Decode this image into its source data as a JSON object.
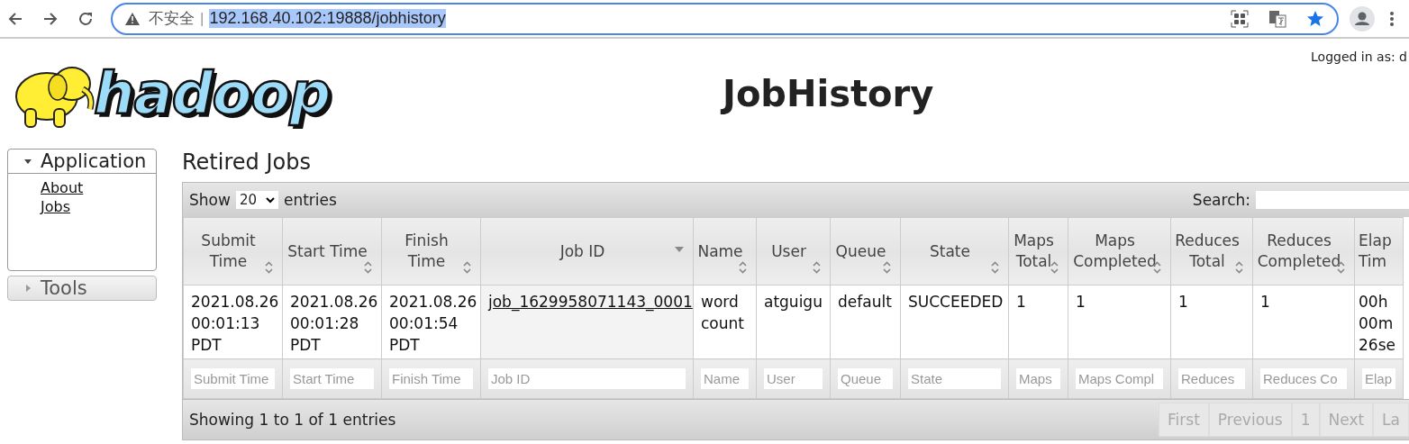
{
  "browser": {
    "security_label": "不安全",
    "separator": "|",
    "url": "192.168.40.102:19888/jobhistory"
  },
  "header": {
    "logo_text": "hadoop",
    "title": "JobHistory",
    "login": "Logged in as: d"
  },
  "sidebar": [
    {
      "label": "Application",
      "expanded": true,
      "items": [
        "About",
        "Jobs"
      ]
    },
    {
      "label": "Tools",
      "expanded": false
    }
  ],
  "main": {
    "heading": "Retired Jobs",
    "show_label": "Show",
    "page_size": "20",
    "entries_label": "entries",
    "search_label": "Search:",
    "columns": [
      {
        "label": "Submit Time",
        "sorted": false
      },
      {
        "label": "Start Time",
        "sorted": false
      },
      {
        "label": "Finish Time",
        "sorted": false
      },
      {
        "label": "Job ID",
        "sorted": true
      },
      {
        "label": "Name",
        "sorted": false
      },
      {
        "label": "User",
        "sorted": false
      },
      {
        "label": "Queue",
        "sorted": false
      },
      {
        "label": "State",
        "sorted": false
      },
      {
        "label": "Maps Total",
        "sorted": false
      },
      {
        "label": "Maps Completed",
        "sorted": false
      },
      {
        "label": "Reduces Total",
        "sorted": false
      },
      {
        "label": "Reduces Completed",
        "sorted": false
      },
      {
        "label": "Elap Tim"
      }
    ],
    "rows": [
      {
        "cells": [
          "2021.08.26 00:01:13 PDT",
          "2021.08.26 00:01:28 PDT",
          "2021.08.26 00:01:54 PDT",
          "job_1629958071143_0001",
          "word count",
          "atguigu",
          "default",
          "SUCCEEDED",
          "1",
          "1",
          "1",
          "1",
          "00h 00m 26se"
        ]
      }
    ],
    "filters": [
      {
        "placeholder": "Submit Time"
      },
      {
        "placeholder": "Start Time"
      },
      {
        "placeholder": "Finish Time"
      },
      {
        "placeholder": "Job ID"
      },
      {
        "placeholder": "Name"
      },
      {
        "placeholder": "User"
      },
      {
        "placeholder": "Queue"
      },
      {
        "placeholder": "State"
      },
      {
        "placeholder": "Maps"
      },
      {
        "placeholder": "Maps Compl"
      },
      {
        "placeholder": "Reduces"
      },
      {
        "placeholder": "Reduces Co"
      },
      {
        "placeholder": "Elap"
      }
    ],
    "info": "Showing 1 to 1 of 1 entries",
    "pager": [
      {
        "label": "First",
        "disabled": true
      },
      {
        "label": "Previous",
        "disabled": true
      },
      {
        "label": "1",
        "disabled": true
      },
      {
        "label": "Next",
        "disabled": true
      },
      {
        "label": "La",
        "disabled": true
      }
    ]
  }
}
